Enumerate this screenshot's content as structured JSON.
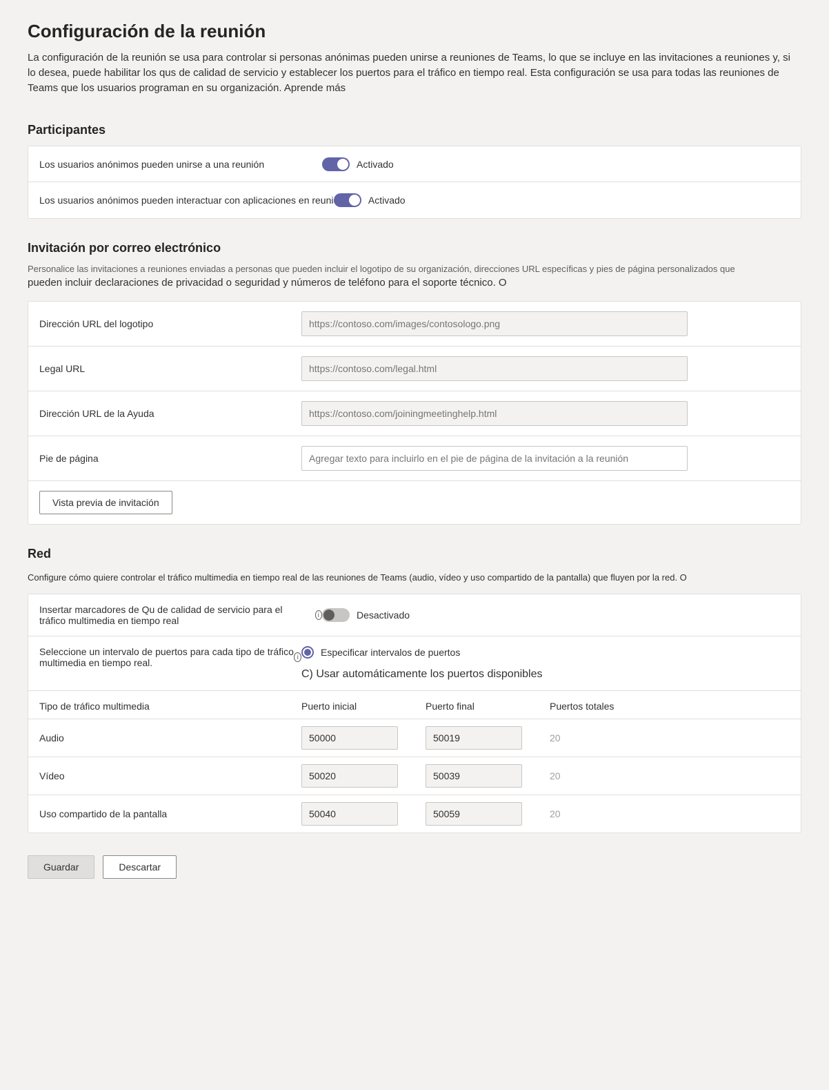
{
  "page": {
    "title": "Configuración de la reunión",
    "description": "La configuración de la reunión se usa para controlar si personas anónimas pueden unirse a reuniones de Teams, lo que se incluye en las invitaciones a reuniones y, si lo desea, puede habilitar los qus de calidad de servicio y establecer los puertos para el tráfico en tiempo real. Esta configuración se usa para todas las reuniones de Teams que los usuarios programan en su organización. Aprende más"
  },
  "participants": {
    "heading": "Participantes",
    "rows": [
      {
        "label": "Los usuarios anónimos pueden unirse a una reunión",
        "state": "on",
        "stateLabel": "Activado"
      },
      {
        "label": "Los usuarios anónimos pueden interactuar con aplicaciones en reuniones",
        "state": "on",
        "stateLabel": "Activado"
      }
    ]
  },
  "email": {
    "heading": "Invitación por correo electrónico",
    "descSmall": "Personalice las invitaciones a reuniones enviadas a personas que pueden incluir el logotipo de su organización, direcciones URL específicas y pies de página personalizados que",
    "descBold": "pueden incluir declaraciones de privacidad o seguridad y números de teléfono para el soporte técnico. O",
    "fields": {
      "logoLabel": "Dirección URL del logotipo",
      "logoPlaceholder": "https://contoso.com/images/contosologo.png",
      "legalLabel": "Legal URL",
      "legalPlaceholder": "https://contoso.com/legal.html",
      "helpLabel": "Dirección URL de la Ayuda",
      "helpPlaceholder": "https://contoso.com/joiningmeetinghelp.html",
      "footerLabel": "Pie de página",
      "footerPlaceholder": "Agregar texto para incluirlo en el pie de página de la invitación a la reunión"
    },
    "previewButton": "Vista previa de invitación"
  },
  "network": {
    "heading": "Red",
    "desc": "Configure cómo quiere controlar el tráfico multimedia en tiempo real de las reuniones de Teams (audio, vídeo y uso compartido de la pantalla) que fluyen por la red. O",
    "qosLabel": "Insertar marcadores de Qu de calidad de servicio para el tráfico multimedia en tiempo real",
    "qosState": "off",
    "qosStateLabel": "Desactivado",
    "portModeLabel": "Seleccione un intervalo de puertos para cada tipo de tráfico multimedia en tiempo real.",
    "portOptionSpecify": "Especificar intervalos de puertos",
    "portOptionAuto": "C) Usar automáticamente los puertos disponibles",
    "table": {
      "headers": {
        "type": "Tipo de tráfico multimedia",
        "start": "Puerto inicial",
        "end": "Puerto final",
        "total": "Puertos totales"
      },
      "rows": [
        {
          "type": "Audio",
          "start": "50000",
          "end": "50019",
          "total": "20"
        },
        {
          "type": "Vídeo",
          "start": "50020",
          "end": "50039",
          "total": "20"
        },
        {
          "type": "Uso compartido de la pantalla",
          "start": "50040",
          "end": "50059",
          "total": "20"
        }
      ]
    }
  },
  "actions": {
    "save": "Guardar",
    "discard": "Descartar"
  }
}
